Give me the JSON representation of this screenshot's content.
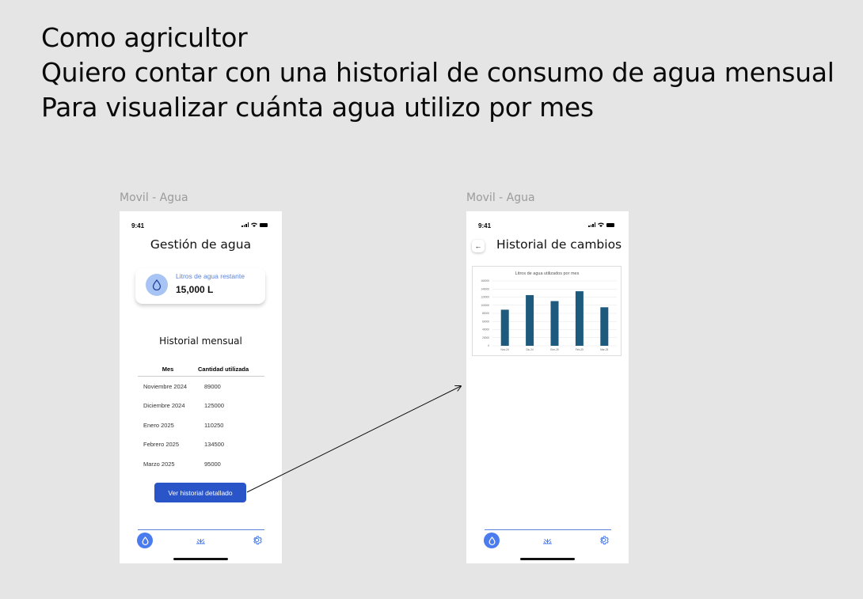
{
  "story": {
    "line1": "Como agricultor",
    "line2": "Quiero contar con una historial de consumo de agua mensual",
    "line3": "Para visualizar cuánta agua utilizo por mes"
  },
  "screen1": {
    "frame_label": "Movil - Agua",
    "time": "9:41",
    "title": "Gestión de agua",
    "card_label": "Litros de agua restante",
    "card_value": "15,000 L",
    "history_title": "Historial mensual",
    "col_month": "Mes",
    "col_amount": "Cantidad utilizada",
    "rows": [
      {
        "month": "Noviembre 2024",
        "amount": "89000"
      },
      {
        "month": "Diciembre 2024",
        "amount": "125000"
      },
      {
        "month": "Enero 2025",
        "amount": "110250"
      },
      {
        "month": "Febrero 2025",
        "amount": "134500"
      },
      {
        "month": "Marzo 2025",
        "amount": "95000"
      }
    ],
    "button_label": "Ver historial detallado"
  },
  "screen2": {
    "frame_label": "Movil - Agua",
    "time": "9:41",
    "back_glyph": "←",
    "title": "Historial de cambios"
  },
  "colors": {
    "primary": "#2a55c9",
    "bar": "#1e5a7d",
    "accent": "#4a7cf0"
  },
  "icons": {
    "nav": [
      "water-drop-icon",
      "plant-icon",
      "gear-icon"
    ]
  },
  "chart_data": {
    "type": "bar",
    "title": "Litros de agua utilizados por mes",
    "categories": [
      "Nov-24",
      "Dic-24",
      "Ene-25",
      "Feb-25",
      "Mar-25"
    ],
    "values": [
      89000,
      125000,
      110250,
      134500,
      95000
    ],
    "yticks": [
      0,
      20000,
      40000,
      60000,
      80000,
      100000,
      120000,
      140000,
      160000
    ],
    "ylim": [
      0,
      160000
    ],
    "grid": true
  }
}
